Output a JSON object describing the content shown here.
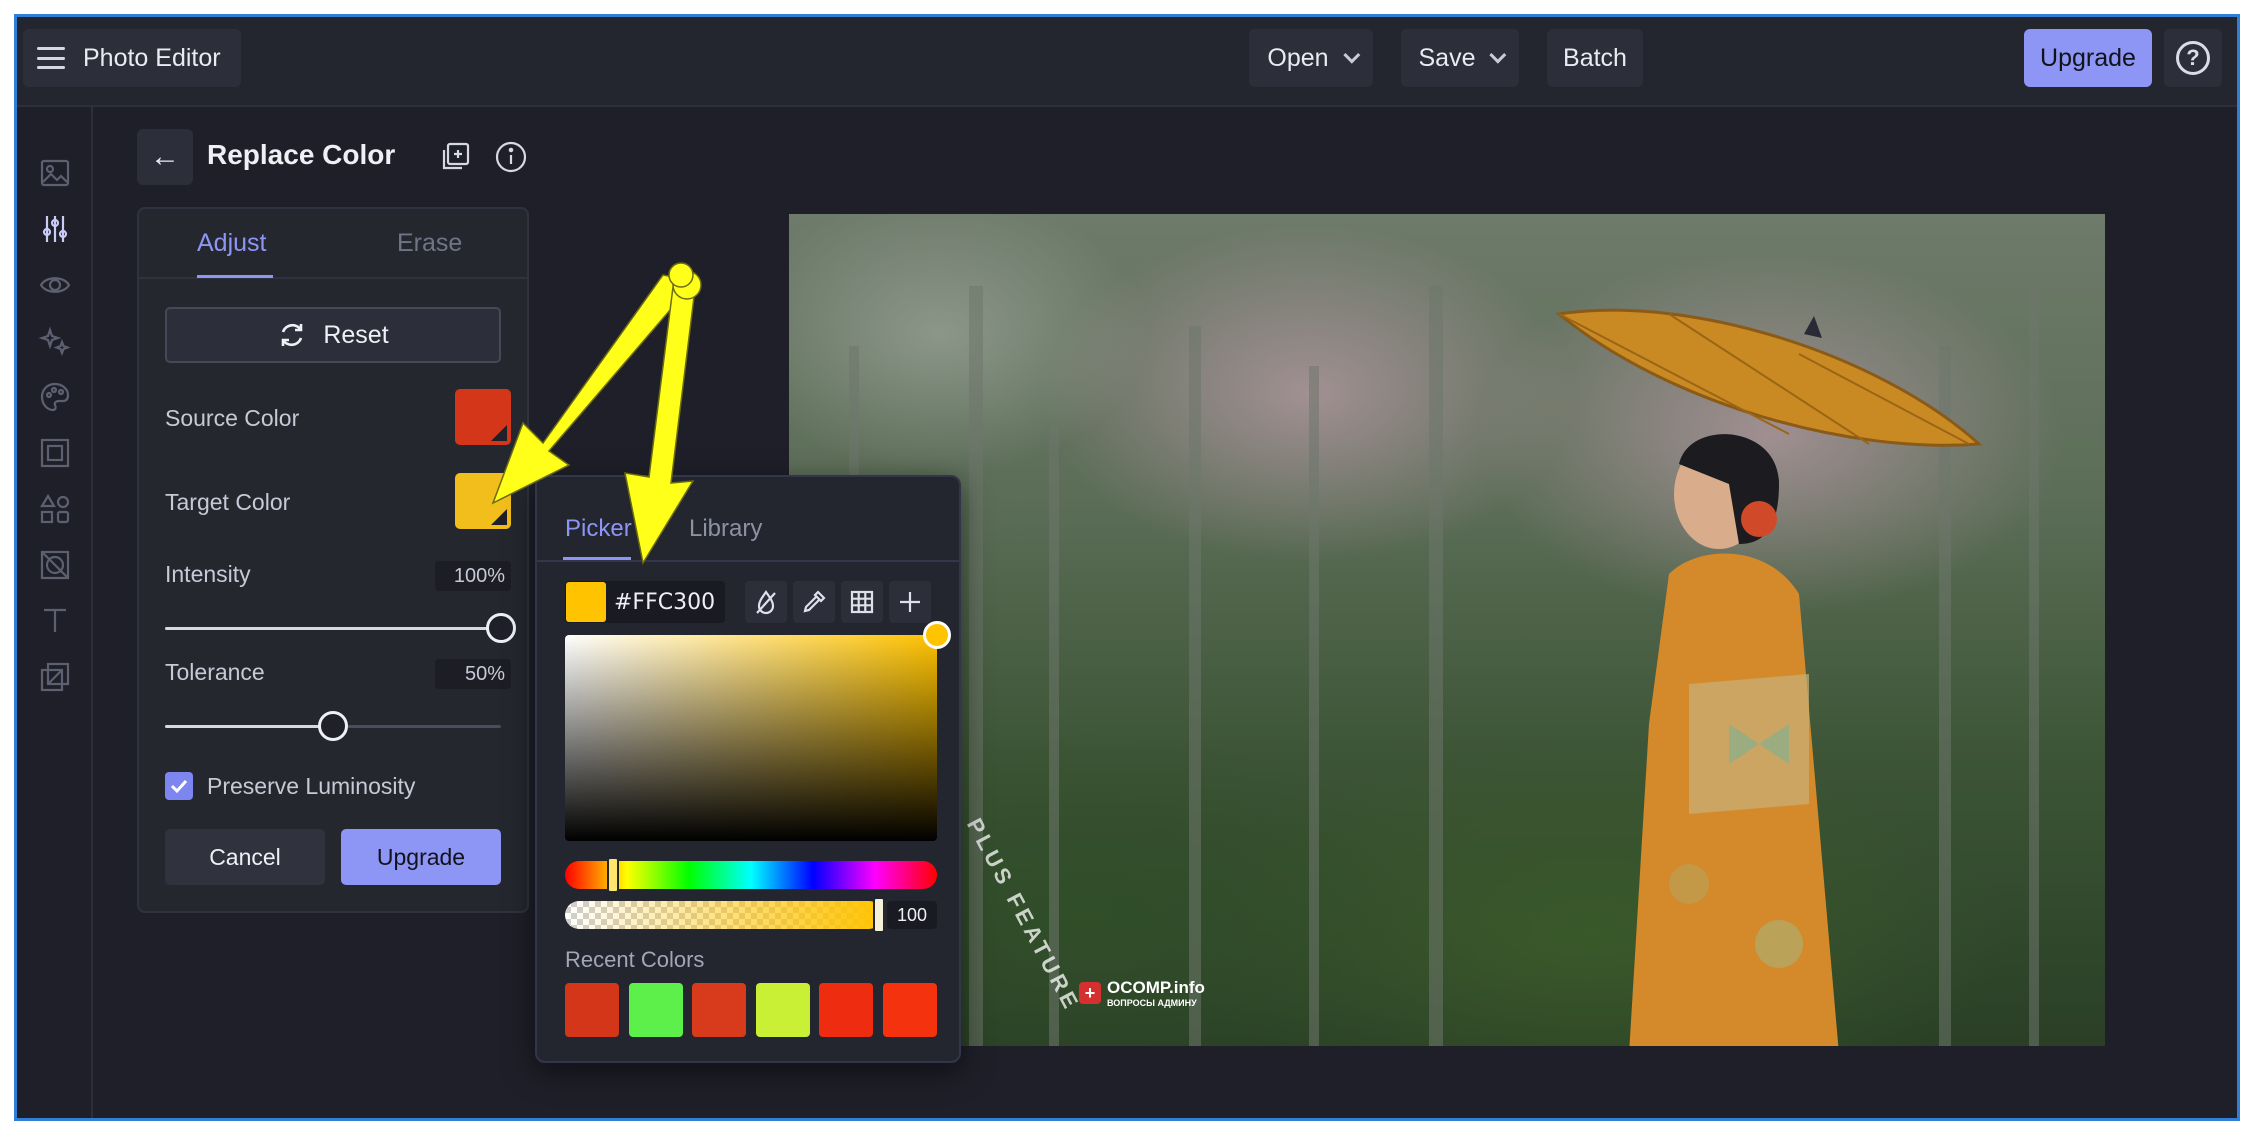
{
  "app": {
    "title": "Photo Editor"
  },
  "topbar": {
    "open_label": "Open",
    "save_label": "Save",
    "batch_label": "Batch",
    "upgrade_label": "Upgrade",
    "help_symbol": "?"
  },
  "rail": {
    "icons": [
      "image-icon",
      "adjust-sliders-icon",
      "eye-icon",
      "sparkle-effects-icon",
      "palette-icon",
      "frame-icon",
      "shapes-icon",
      "texture-icon",
      "text-icon",
      "overlay-icon"
    ],
    "active": "adjust-sliders-icon"
  },
  "panel": {
    "title": "Replace Color",
    "tabs": [
      {
        "label": "Adjust",
        "active": true
      },
      {
        "label": "Erase",
        "active": false
      }
    ],
    "reset_label": "Reset",
    "source_color_label": "Source Color",
    "source_color": "#d4361a",
    "target_color_label": "Target Color",
    "target_color": "#f2be1c",
    "intensity_label": "Intensity",
    "intensity_value": "100%",
    "intensity_fraction": 1.0,
    "tolerance_label": "Tolerance",
    "tolerance_value": "50%",
    "tolerance_fraction": 0.5,
    "preserve_label": "Preserve Luminosity",
    "preserve_checked": true,
    "cancel_label": "Cancel",
    "upgrade_label": "Upgrade"
  },
  "picker": {
    "tabs": [
      {
        "label": "Picker",
        "active": true
      },
      {
        "label": "Library",
        "active": false
      }
    ],
    "hex_value": "#FFC300",
    "current_color": "#ffc300",
    "alpha_value": "100",
    "recent_label": "Recent Colors",
    "recent_colors": [
      "#d4361a",
      "#5ef04a",
      "#d83a1c",
      "#c9f034",
      "#ee2c10",
      "#f4320e"
    ]
  },
  "watermark": {
    "circle_text": "PLUS FEATURE",
    "site": "OCOMP.info",
    "tagline": "ВОПРОСЫ АДМИНУ"
  },
  "colors": {
    "accent": "#8d95f5",
    "frame_border": "#2f7fd6",
    "background": "#1e1f28",
    "annotation_arrow": "#ffff1a"
  }
}
